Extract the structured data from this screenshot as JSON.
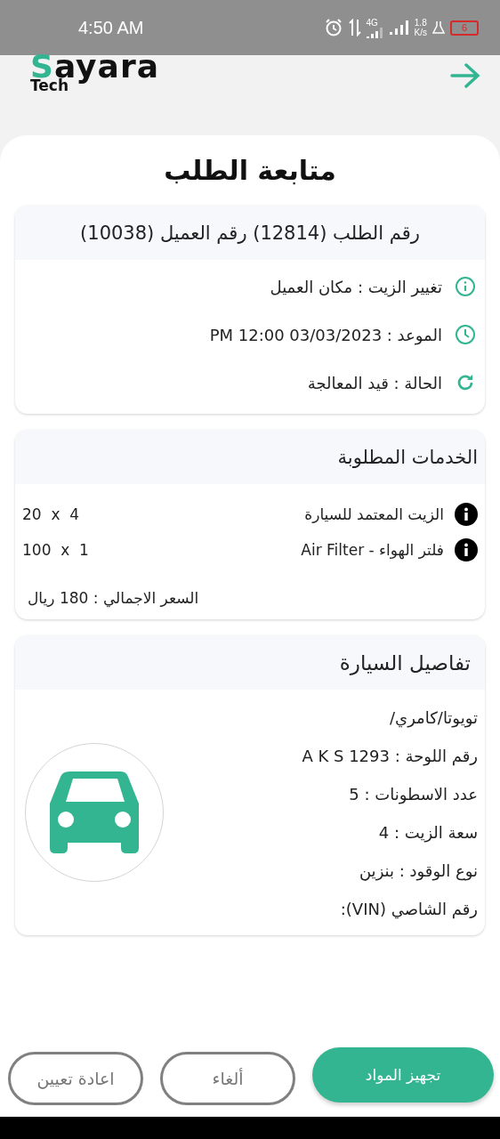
{
  "status_bar": {
    "time": "4:50 AM",
    "network": "4G",
    "speed": "1.8",
    "speed_unit": "K/s",
    "battery": "6"
  },
  "header": {
    "logo": {
      "accent": "S",
      "name": "ayara",
      "sub": "Tech"
    }
  },
  "title": "متابعة الطلب",
  "order_card": {
    "heading": "رقم الطلب (12814) رقم العميل (10038)",
    "rows": [
      {
        "kind": "info",
        "text": "تغيير الزيت : مكان العميل"
      },
      {
        "kind": "time",
        "text": "الموعد : 03/03/2023 12:00 PM"
      },
      {
        "kind": "status",
        "text": "الحالة : قيد المعالجة"
      }
    ]
  },
  "services_card": {
    "heading": "الخدمات المطلوبة",
    "items": [
      {
        "name": "الزيت المعتمد للسيارة",
        "amount": "20  x  4"
      },
      {
        "name": "فلتر الهواء - Air Filter",
        "amount": "100  x  1"
      }
    ],
    "total": "السعر الاجمالي : 180 ريال"
  },
  "car_card": {
    "heading": "تفاصيل السيارة",
    "lines": [
      "تويوتا/كامري/",
      "رقم اللوحة : A K S 1293",
      "عدد الاسطونات : 5",
      "سعة الزيت : 4",
      "نوع الوقود : بنزين",
      "رقم الشاصي (VIN):"
    ]
  },
  "buttons": [
    {
      "label": "تجهيز المواد",
      "kind": "primary"
    },
    {
      "label": "ألغاء",
      "kind": "outline"
    },
    {
      "label": "اعادة تعيين",
      "kind": "outline"
    }
  ]
}
